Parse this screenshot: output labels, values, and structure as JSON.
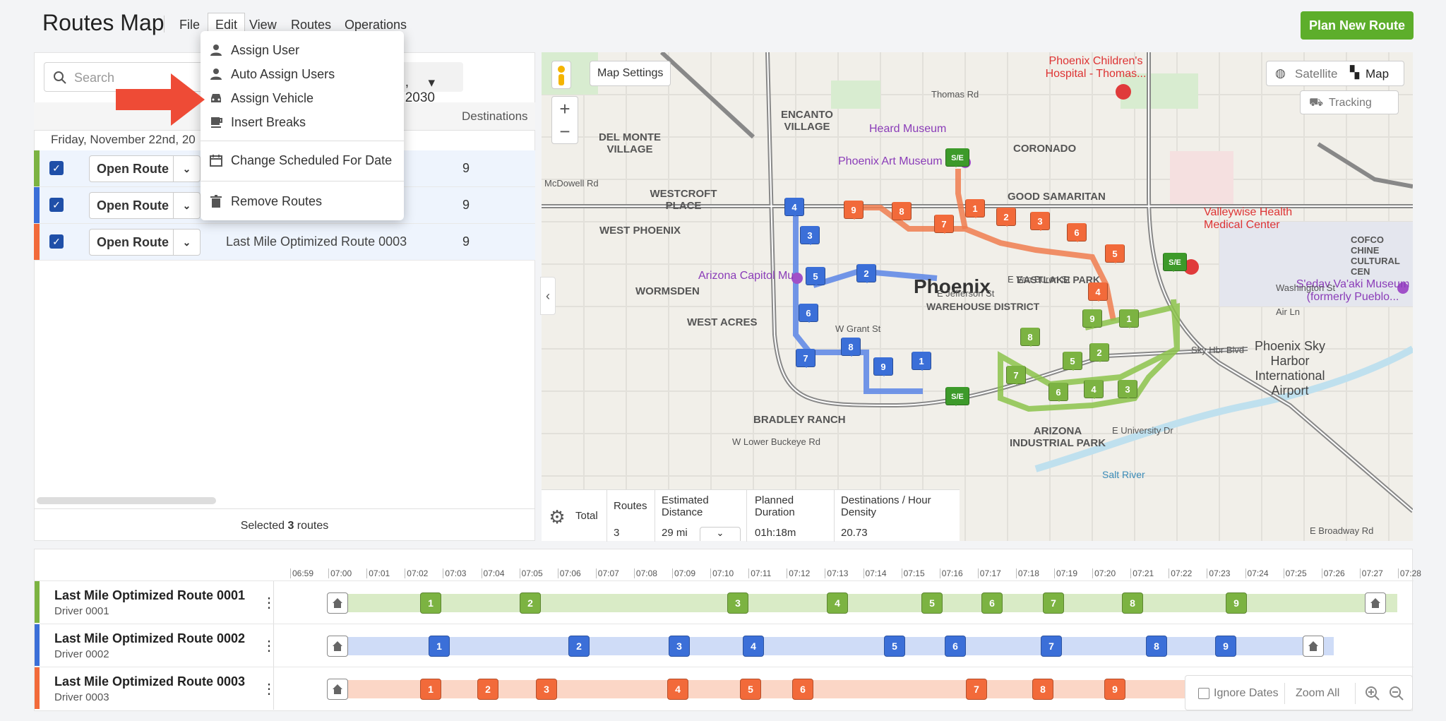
{
  "app": {
    "title": "Routes Map",
    "plan_button": "Plan New Route"
  },
  "menubar": [
    "File",
    "Edit",
    "View",
    "Routes",
    "Operations"
  ],
  "edit_menu": {
    "items": [
      {
        "label": "Assign User",
        "icon": "user-icon"
      },
      {
        "label": "Auto Assign Users",
        "icon": "user-icon"
      },
      {
        "label": "Assign Vehicle",
        "icon": "car-icon"
      },
      {
        "label": "Insert Breaks",
        "icon": "coffee-icon"
      },
      {
        "label": "Change Scheduled For Date",
        "icon": "calendar-icon"
      },
      {
        "label": "Remove Routes",
        "icon": "trash-icon"
      }
    ]
  },
  "left_panel": {
    "search_placeholder": "Search",
    "date_filter": ", 2030",
    "col_destinations": "Destinations",
    "date_group": "Friday, November 22nd, 20",
    "open_route_label": "Open Route",
    "rows": [
      {
        "name": "",
        "destinations": "9",
        "color": "#7cb342"
      },
      {
        "name": "",
        "destinations": "9",
        "color": "#3b6fd8"
      },
      {
        "name": "Last Mile Optimized Route 0003",
        "destinations": "9",
        "color": "#f26a3a"
      }
    ],
    "selected_prefix": "Selected",
    "selected_count": "3",
    "selected_suffix": "routes"
  },
  "map": {
    "settings": "Map Settings",
    "satellite": "Satellite",
    "map_label": "Map",
    "tracking": "Tracking",
    "labels": [
      "Phoenix",
      "WAREHOUSE DISTRICT",
      "EASTLAKE PARK",
      "WEST ACRES",
      "WORMSDEN",
      "BRADLEY RANCH",
      "CORONADO",
      "GOOD SAMARITAN",
      "WESTCROFT PLACE",
      "WEST PHOENIX",
      "DEL MONTE VILLAGE",
      "ENCANTO VILLAGE",
      "ARIZONA INDUSTRIAL PARK",
      "Phoenix Sky Harbor International Airport",
      "Heard Museum",
      "Phoenix Art Museum",
      "Arizona Capitol Mu",
      "Valleywise Health Medical Center",
      "Phoenix Children's Hospital - Thomas...",
      "S'edav Va'aki Museum (formerly Pueblo...",
      "COFCO CHINE CULTURAL CEN",
      "Thomas Rd",
      "McDowell Rd",
      "Washington St",
      "Air Ln",
      "Sky Hbr Blvd",
      "E University Dr",
      "Salt River",
      "E Broadway Rd",
      "W Lower Buckeye Rd",
      "E Jefferson St",
      "E Van Buren St",
      "W Grant St"
    ]
  },
  "summary": {
    "total": "Total",
    "headers": [
      "Routes",
      "Estimated Distance",
      "Planned Duration",
      "Destinations / Hour Density"
    ],
    "values": [
      "3",
      "29 mi",
      "01h:18m",
      "20.73"
    ]
  },
  "timeline": {
    "ticks": [
      "06:59",
      "07:00",
      "07:01",
      "07:02",
      "07:03",
      "07:04",
      "07:05",
      "07:06",
      "07:07",
      "07:08",
      "07:09",
      "07:10",
      "07:11",
      "07:12",
      "07:13",
      "07:14",
      "07:15",
      "07:16",
      "07:17",
      "07:18",
      "07:19",
      "07:20",
      "07:21",
      "07:22",
      "07:23",
      "07:24",
      "07:25",
      "07:26",
      "07:27",
      "07:28"
    ],
    "routes": [
      {
        "name": "Last Mile Optimized Route 0001",
        "driver": "Driver 0001",
        "color": "#7cb342",
        "band": "#d9ebc6",
        "stops": [
          "1",
          "2",
          "3",
          "4",
          "5",
          "6",
          "7",
          "8",
          "9"
        ]
      },
      {
        "name": "Last Mile Optimized Route 0002",
        "driver": "Driver 0002",
        "color": "#3b6fd8",
        "band": "#cfdcf7",
        "stops": [
          "1",
          "2",
          "3",
          "4",
          "5",
          "6",
          "7",
          "8",
          "9"
        ]
      },
      {
        "name": "Last Mile Optimized Route 0003",
        "driver": "Driver 0003",
        "color": "#f26a3a",
        "band": "#fbd6c6",
        "stops": [
          "1",
          "2",
          "3",
          "4",
          "5",
          "6",
          "7",
          "8",
          "9"
        ]
      }
    ],
    "ignore_dates": "Ignore Dates",
    "zoom_all": "Zoom All"
  }
}
